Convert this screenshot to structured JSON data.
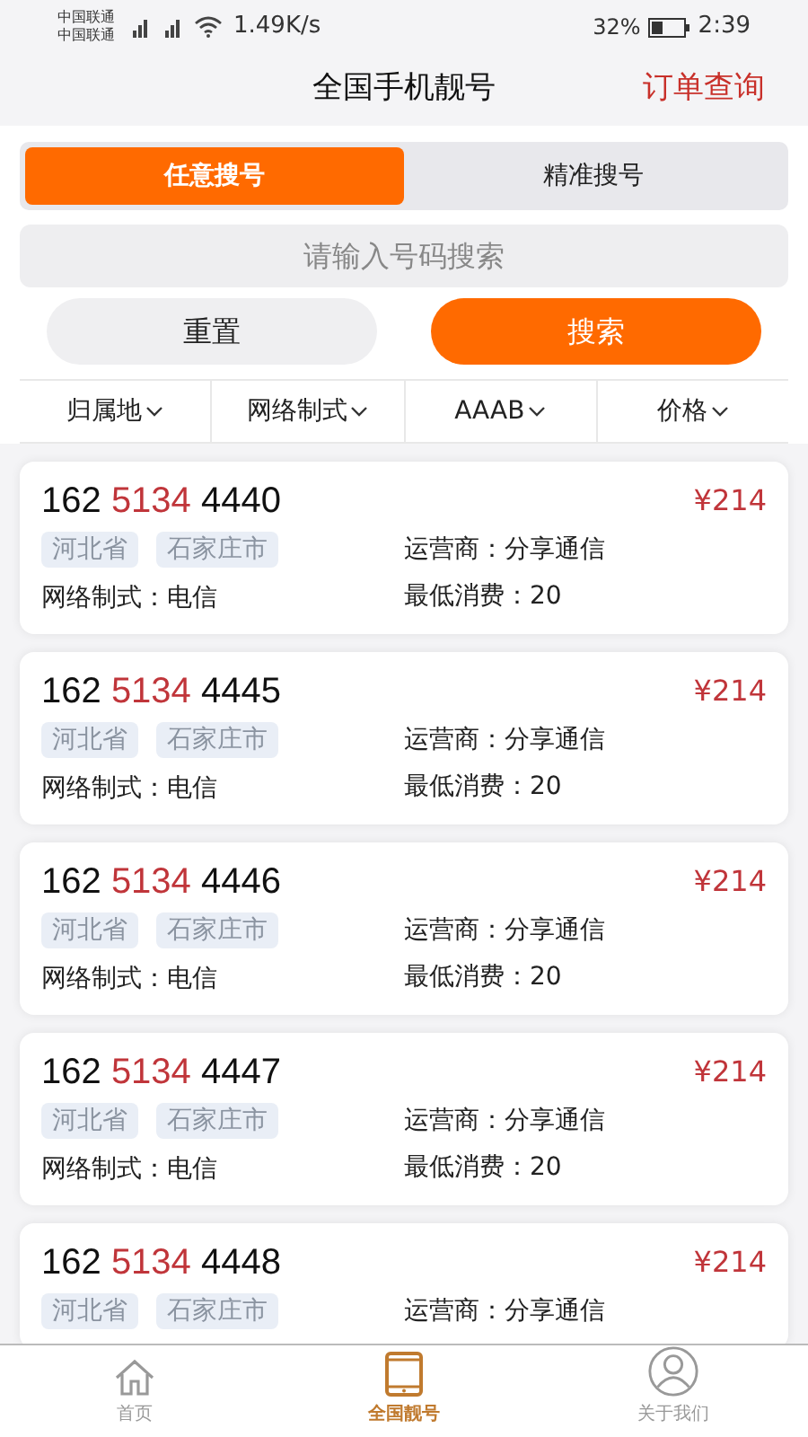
{
  "status_bar": {
    "carriers": [
      "中国联通",
      "中国联通"
    ],
    "speed": "1.49K/s",
    "battery": "32%",
    "time": "2:39"
  },
  "header": {
    "title": "全国手机靓号",
    "action": "订单查询"
  },
  "tabs": [
    {
      "label": "任意搜号",
      "selected": true
    },
    {
      "label": "精准搜号",
      "selected": false
    }
  ],
  "search": {
    "placeholder": "请输入号码搜索"
  },
  "buttons": [
    {
      "label": "重置",
      "kind": "secondary"
    },
    {
      "label": "搜索",
      "kind": "primary"
    }
  ],
  "filters": [
    "归属地",
    "网络制式",
    "AAAB",
    "价格"
  ],
  "numbers": [
    {
      "prefix": "162",
      "middle": "5134",
      "suffix": "4440",
      "price": "¥214",
      "tags": [
        "河北省",
        "石家庄市"
      ],
      "operator": "运营商：分享通信",
      "network": "网络制式：电信",
      "min_spend": "最低消费：20"
    },
    {
      "prefix": "162",
      "middle": "5134",
      "suffix": "4445",
      "price": "¥214",
      "tags": [
        "河北省",
        "石家庄市"
      ],
      "operator": "运营商：分享通信",
      "network": "网络制式：电信",
      "min_spend": "最低消费：20"
    },
    {
      "prefix": "162",
      "middle": "5134",
      "suffix": "4446",
      "price": "¥214",
      "tags": [
        "河北省",
        "石家庄市"
      ],
      "operator": "运营商：分享通信",
      "network": "网络制式：电信",
      "min_spend": "最低消费：20"
    },
    {
      "prefix": "162",
      "middle": "5134",
      "suffix": "4447",
      "price": "¥214",
      "tags": [
        "河北省",
        "石家庄市"
      ],
      "operator": "运营商：分享通信",
      "network": "网络制式：电信",
      "min_spend": "最低消费：20"
    },
    {
      "prefix": "162",
      "middle": "5134",
      "suffix": "4448",
      "price": "¥214",
      "tags": [
        "河北省",
        "石家庄市"
      ],
      "operator": "运营商：分享通信"
    }
  ],
  "tab_bar": [
    {
      "label": "首页",
      "kind": "home",
      "selected": false
    },
    {
      "label": "全国靓号",
      "kind": "tablet",
      "selected": true
    },
    {
      "label": "关于我们",
      "kind": "person",
      "selected": false
    }
  ]
}
